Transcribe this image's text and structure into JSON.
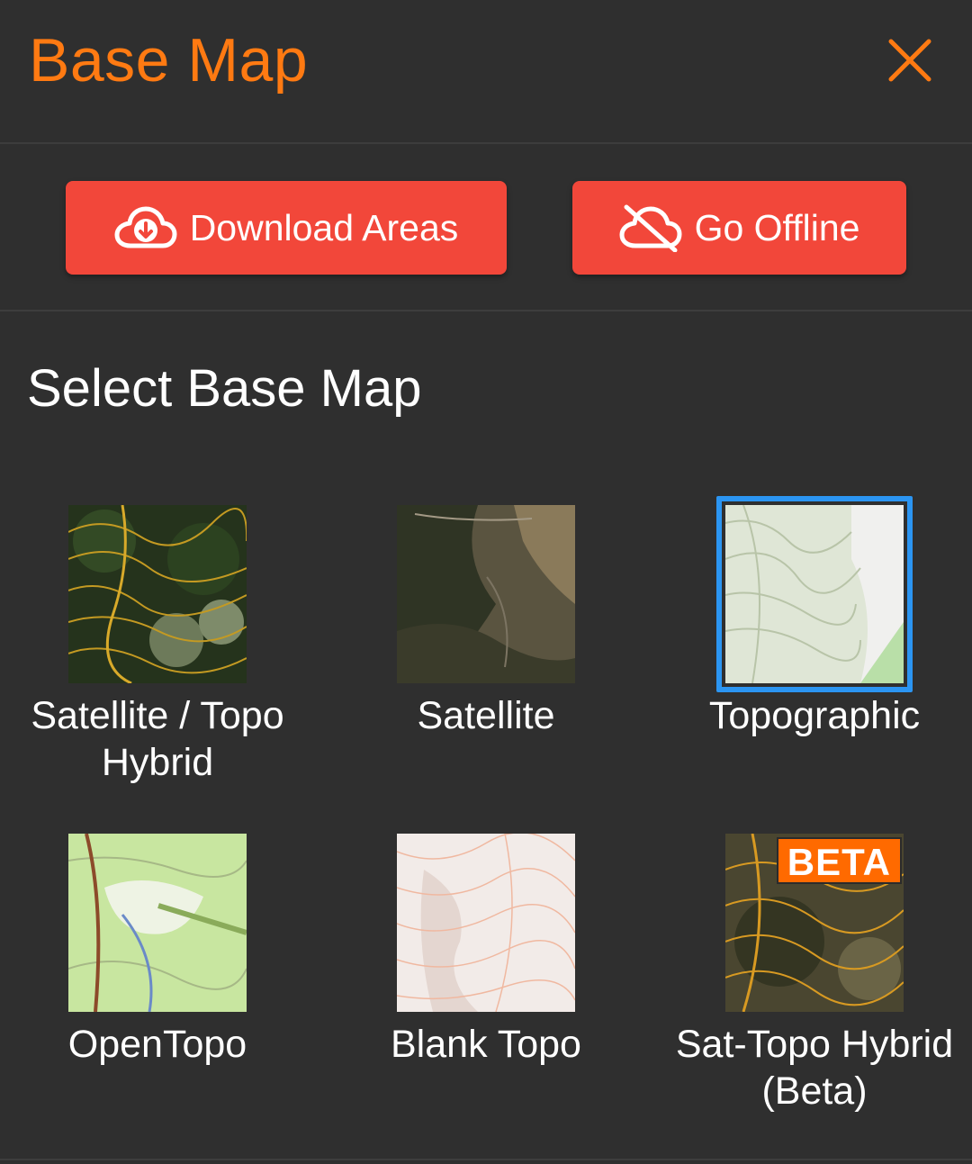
{
  "header": {
    "title": "Base Map"
  },
  "actions": {
    "download_label": "Download Areas",
    "offline_label": "Go Offline"
  },
  "section": {
    "title": "Select Base Map"
  },
  "maps": [
    {
      "label": "Satellite / Topo\nHybrid",
      "selected": false
    },
    {
      "label": "Satellite",
      "selected": false
    },
    {
      "label": "Topographic",
      "selected": true
    },
    {
      "label": "OpenTopo",
      "selected": false
    },
    {
      "label": "Blank Topo",
      "selected": false
    },
    {
      "label": "Sat-Topo Hybrid\n(Beta)",
      "selected": false,
      "badge": "BETA"
    }
  ],
  "colors": {
    "accent": "#ff7a12",
    "button": "#f2473a",
    "selected_border": "#2b95f2",
    "background": "#2f2f2f"
  }
}
